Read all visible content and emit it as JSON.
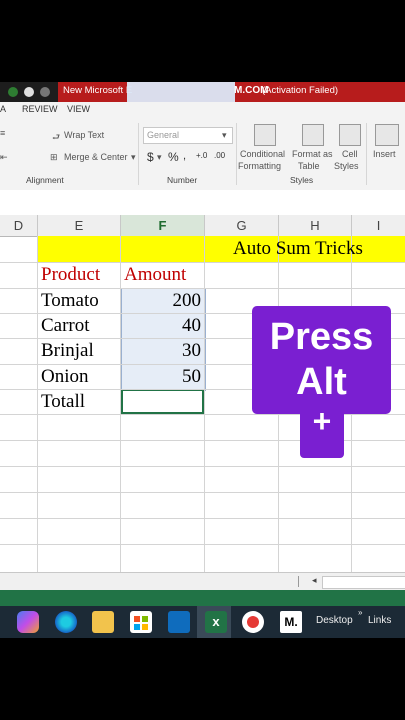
{
  "titlebar": {
    "left_text": "New Microsoft E",
    "logo": "M.COM",
    "right_text": "(Activation Failed)"
  },
  "menu": {
    "items": [
      "A",
      "REVIEW",
      "VIEW"
    ]
  },
  "ribbon": {
    "wrap_text": "Wrap Text",
    "merge_center": "Merge & Center",
    "number_format": "General",
    "currency_symbol": "$",
    "percent_symbol": "%",
    "conditional_formatting_line1": "Conditional",
    "conditional_formatting_line2": "Formatting",
    "format_as_table_line1": "Format as",
    "format_as_table_line2": "Table",
    "cell_styles_line1": "Cell",
    "cell_styles_line2": "Styles",
    "insert": "Insert",
    "group_alignment": "Alignment",
    "group_number": "Number",
    "group_styles": "Styles"
  },
  "columns": [
    "D",
    "E",
    "F",
    "G",
    "H",
    "I"
  ],
  "sheet": {
    "title": "Auto Sum Tricks",
    "header_product": "Product",
    "header_amount": "Amount",
    "rows": [
      {
        "product": "Tomato",
        "amount": "200"
      },
      {
        "product": "Carrot",
        "amount": "40"
      },
      {
        "product": "Brinjal",
        "amount": "30"
      },
      {
        "product": "Onion",
        "amount": "50"
      }
    ],
    "total_label": "Totall"
  },
  "overlay": {
    "line1": "Press",
    "line2": "Alt",
    "line3": "+"
  },
  "taskbar": {
    "desktop": "Desktop",
    "links": "Links"
  },
  "colors": {
    "excel_green": "#217346",
    "overlay_purple": "#7a1fd1",
    "title_red": "#b71c1c",
    "header_yellow": "#ffff00"
  }
}
